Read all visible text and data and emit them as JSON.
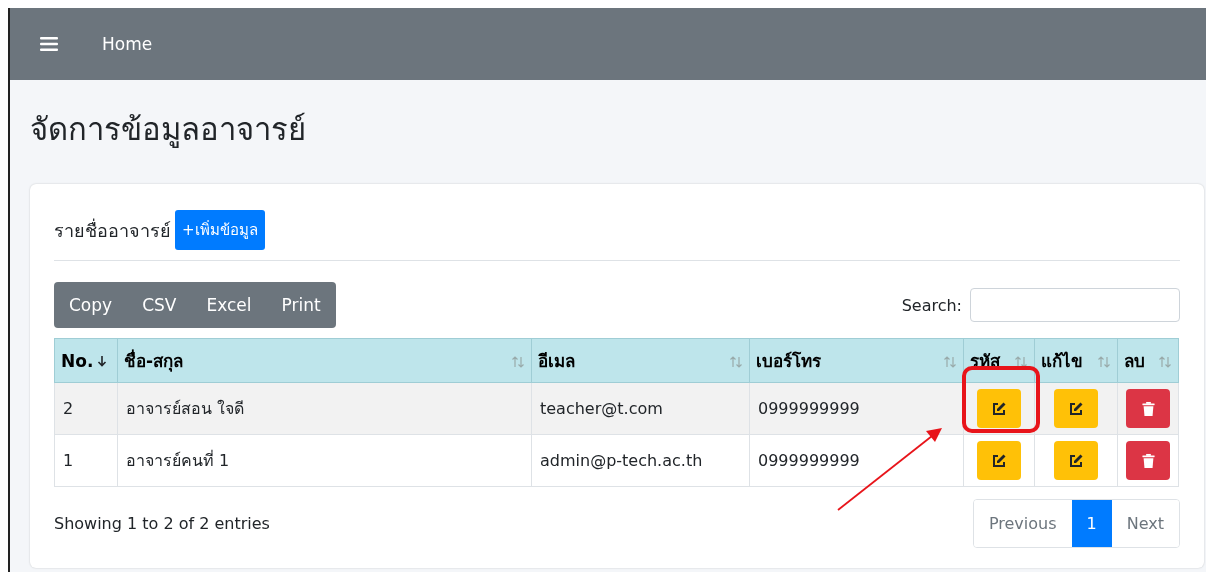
{
  "navbar": {
    "home_link": "Home"
  },
  "page_title": "จัดการข้อมูลอาจารย์",
  "card": {
    "title": "รายชื่ออาจารย์",
    "add_button": "+เพิ่มข้อมูล"
  },
  "export_buttons": [
    "Copy",
    "CSV",
    "Excel",
    "Print"
  ],
  "search": {
    "label": "Search:"
  },
  "table": {
    "columns": [
      {
        "label": "No.",
        "kind": "text",
        "sorted": true
      },
      {
        "label": "ชื่อ-สกุล",
        "kind": "text",
        "sorted": false
      },
      {
        "label": "อีเมล",
        "kind": "text",
        "sorted": false
      },
      {
        "label": "เบอร์โทร",
        "kind": "text",
        "sorted": false
      },
      {
        "label": "รหัส",
        "kind": "edit",
        "sorted": false
      },
      {
        "label": "แก้ไข",
        "kind": "edit",
        "sorted": false
      },
      {
        "label": "ลบ",
        "kind": "delete",
        "sorted": false
      }
    ],
    "rows": [
      {
        "cells": [
          "2",
          "อาจารย์สอน ใจดี",
          "teacher@t.com",
          "0999999999"
        ]
      },
      {
        "cells": [
          "1",
          "อาจารย์คนที่ 1",
          "admin@p-tech.ac.th",
          "0999999999"
        ]
      }
    ]
  },
  "info": "Showing 1 to 2 of 2 entries",
  "pagination": [
    {
      "label": "Previous",
      "selected": false
    },
    {
      "label": "1",
      "selected": true
    },
    {
      "label": "Next",
      "selected": false
    }
  ]
}
